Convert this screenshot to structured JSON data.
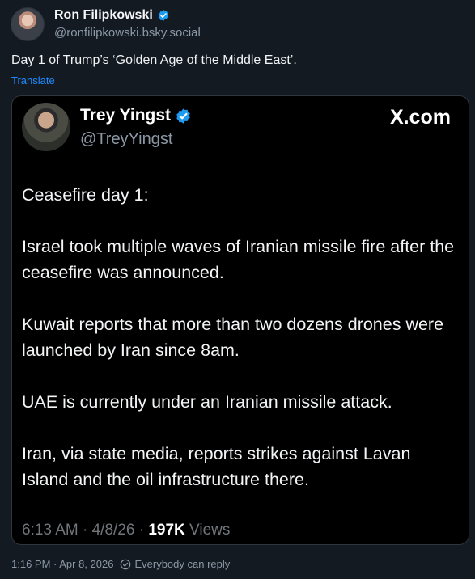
{
  "post": {
    "author_name": "Ron Filipkowski",
    "author_handle": "@ronfilipkowski.bsky.social",
    "text": "Day 1 of Trump’s ‘Golden Age of the Middle East’.",
    "translate_label": "Translate",
    "timestamp": "1:16 PM · Apr 8, 2026",
    "reply_setting": "Everybody can reply"
  },
  "embed": {
    "author_name": "Trey Yingst",
    "author_handle": "@TreyYingst",
    "source_logo": "X.com",
    "paragraphs": [
      "Ceasefire day 1:",
      "Israel took multiple waves of Iranian missile fire after the ceasefire was announced.",
      "Kuwait reports that more than two dozens drones were launched by Iran since 8am.",
      "UAE is currently under an Iranian missile attack.",
      "Iran, via state media, reports strikes against Lavan Island and the oil infrastructure there."
    ],
    "meta_time": "6:13 AM · 4/8/26 · ",
    "views_count": "197K",
    "views_label": " Views"
  },
  "colors": {
    "verified": "#1d9bf0",
    "link": "#208bfe",
    "background": "#141a22"
  },
  "icons": {
    "verified": "verified-badge-icon",
    "reply": "reply-settings-icon"
  }
}
